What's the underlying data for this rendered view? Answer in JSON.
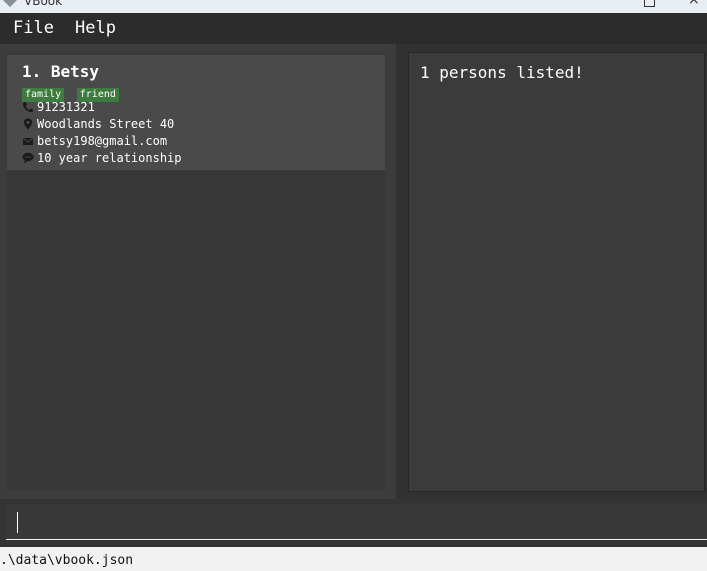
{
  "window": {
    "title": "VBook"
  },
  "menu": {
    "items": [
      "File",
      "Help"
    ]
  },
  "person_list": {
    "cards": [
      {
        "index_name": "1. Betsy",
        "tags": [
          "family",
          "friend"
        ],
        "phone": "91231321",
        "address": "Woodlands Street 40",
        "email": "betsy198@gmail.com",
        "remark": "10 year relationship"
      }
    ]
  },
  "result_display": {
    "text": "1 persons listed!"
  },
  "command_box": {
    "value": "",
    "placeholder": ""
  },
  "status_bar": {
    "save_location": ".\\data\\vbook.json"
  },
  "colors": {
    "tag_bg": "#3e7b3e",
    "card_bg": "#4a4a4a",
    "menu_bg": "#2c2c2c",
    "background": "#383838"
  },
  "icons": [
    "phone-icon",
    "location-icon",
    "email-icon",
    "remark-icon",
    "app-icon",
    "maximize-icon",
    "close-icon"
  ]
}
